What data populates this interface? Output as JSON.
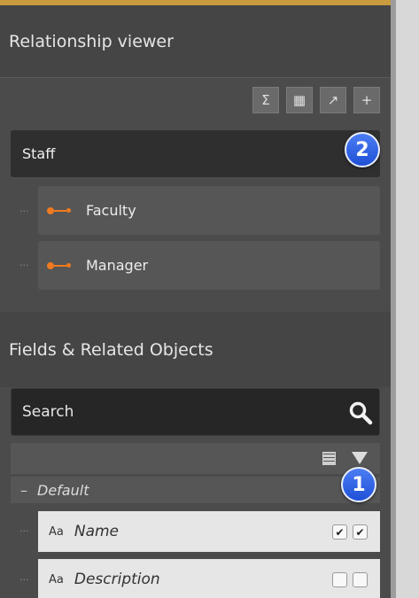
{
  "relationship_viewer": {
    "title": "Relationship viewer",
    "toolbar": {
      "sum_label": "Σ",
      "calc_label": "▦",
      "open_label": "↗",
      "add_label": "+"
    },
    "root": {
      "label": "Staff"
    },
    "children": [
      {
        "label": "Faculty"
      },
      {
        "label": "Manager"
      }
    ]
  },
  "fields": {
    "title": "Fields & Related Objects",
    "search": {
      "placeholder": "Search"
    },
    "group": {
      "toggle": "–",
      "label": "Default"
    },
    "items": [
      {
        "type_icon": "Aa",
        "name": "Name",
        "check1": "✔",
        "check2": "✔"
      },
      {
        "type_icon": "Aa",
        "name": "Description",
        "check1": "",
        "check2": ""
      }
    ]
  },
  "callouts": {
    "badge_1": "1",
    "badge_2": "2"
  },
  "colors": {
    "accent_strip": "#c99a3e",
    "badge_blue": "#2f63e6",
    "relation_orange": "#f07a20",
    "panel_bg": "#4b4b4b"
  }
}
